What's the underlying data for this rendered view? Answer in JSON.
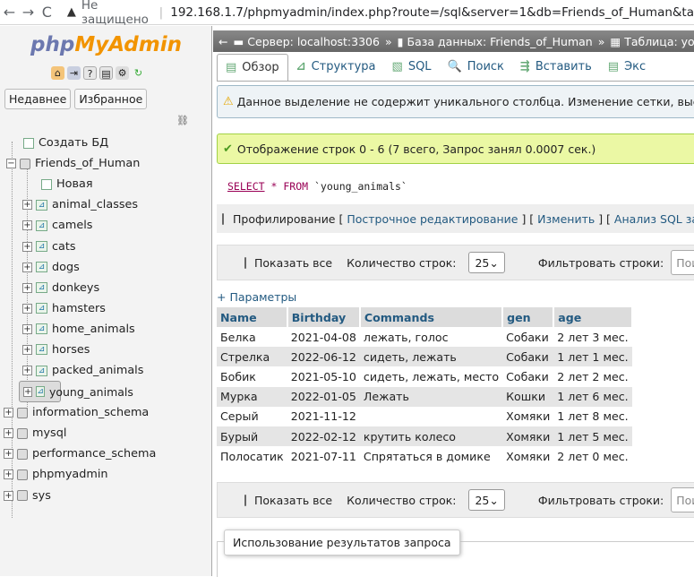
{
  "browser": {
    "back": "←",
    "forward": "→",
    "reload": "C",
    "security_label": "Не защищено",
    "url": "192.168.1.7/phpmyadmin/index.php?route=/sql&server=1&db=Friends_of_Human&ta"
  },
  "sidebar": {
    "logo_php": "php",
    "logo_myadmin": "MyAdmin",
    "recent_label": "Недавнее",
    "favorites_label": "Избранное",
    "create_db_label": "Создать БД",
    "databases": [
      {
        "name": "Friends_of_Human"
      },
      {
        "name": "information_schema"
      },
      {
        "name": "mysql"
      },
      {
        "name": "performance_schema"
      },
      {
        "name": "phpmyadmin"
      },
      {
        "name": "sys"
      }
    ],
    "new_label": "Новая",
    "tables": [
      "animal_classes",
      "camels",
      "cats",
      "dogs",
      "donkeys",
      "hamsters",
      "home_animals",
      "horses",
      "packed_animals",
      "young_animals"
    ],
    "selected_table": "young_animals"
  },
  "breadcrumb": {
    "server": "Сервер: localhost:3306",
    "database": "База данных: Friends_of_Human",
    "table": "Таблица: yo"
  },
  "tabs": [
    {
      "label": "Обзор",
      "icon": "browse-icon"
    },
    {
      "label": "Структура",
      "icon": "structure-icon"
    },
    {
      "label": "SQL",
      "icon": "sql-icon"
    },
    {
      "label": "Поиск",
      "icon": "search-icon"
    },
    {
      "label": "Вставить",
      "icon": "insert-icon"
    },
    {
      "label": "Экс",
      "icon": "export-icon"
    }
  ],
  "warning_text": "Данное выделение не содержит уникального столбца. Изменение сетки, выставл",
  "success_text": "Отображение строк 0 - 6 (7 всего, Запрос занял 0.0007 сек.)",
  "sql": {
    "select": "SELECT",
    "star": "*",
    "from": "FROM",
    "table": "`young_animals`"
  },
  "profiling": {
    "label": "Профилирование",
    "inline_edit": "Построчное редактирование",
    "edit": "Изменить",
    "analyze": "Анализ SQL запро"
  },
  "navbar": {
    "show_all": "Показать все",
    "rows_label": "Количество строк:",
    "rows_value": "25",
    "filter_label": "Фильтровать строки:",
    "filter_placeholder": "Поис"
  },
  "params_label": "+ Параметры",
  "results": {
    "columns": [
      "Name",
      "Birthday",
      "Commands",
      "gen",
      "age"
    ],
    "rows": [
      [
        "Белка",
        "2021-04-08",
        "лежать, голос",
        "Собаки",
        "2 лет 3 мес."
      ],
      [
        "Стрелка",
        "2022-06-12",
        "сидеть, лежать",
        "Собаки",
        "1 лет 1 мес."
      ],
      [
        "Бобик",
        "2021-05-10",
        "сидеть, лежать, место",
        "Собаки",
        "2 лет 2 мес."
      ],
      [
        "Мурка",
        "2022-01-05",
        "Лежать",
        "Кошки",
        "1 лет 6 мес."
      ],
      [
        "Серый",
        "2021-11-12",
        "",
        "Хомяки",
        "1 лет 8 мес."
      ],
      [
        "Бурый",
        "2022-02-12",
        "крутить колесо",
        "Хомяки",
        "1 лет 5 мес."
      ],
      [
        "Полосатик",
        "2021-07-11",
        "Спрятаться в домике",
        "Хомяки",
        "2 лет 0 мес."
      ]
    ]
  },
  "usage_label": "Использование результатов запроса"
}
